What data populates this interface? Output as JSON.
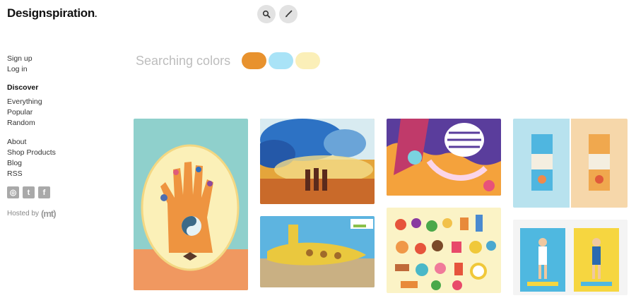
{
  "header": {
    "logo_text": "Designspiration",
    "logo_suffix": "."
  },
  "top_buttons": [
    {
      "icon": "search-icon"
    },
    {
      "icon": "brush-icon"
    }
  ],
  "sidebar": {
    "auth": [
      "Sign up",
      "Log in"
    ],
    "discover_heading": "Discover",
    "discover_items": [
      "Everything",
      "Popular",
      "Random"
    ],
    "info_items": [
      "About",
      "Shop Products",
      "Blog",
      "RSS"
    ],
    "social_icons": [
      "instagram-icon",
      "twitter-icon",
      "facebook-icon"
    ],
    "social_glyphs": [
      "◎",
      "t",
      "f"
    ],
    "hosted_by": "Hosted by",
    "hosted_logo": "(mt)"
  },
  "search": {
    "label": "Searching colors",
    "colors": [
      "#e8922e",
      "#a9e3f7",
      "#fbefb8"
    ]
  },
  "tiles": [
    {
      "subject": "hand-illustration",
      "colors": [
        "#8fd0cc",
        "#f08a4b"
      ]
    },
    {
      "subject": "colorful-smoke-photo",
      "colors": [
        "#2a78c8",
        "#e5a23c"
      ]
    },
    {
      "subject": "abstract-face-illustration",
      "colors": [
        "#5a3d9c",
        "#f4a23c"
      ]
    },
    {
      "subject": "coconut-water-packaging",
      "colors": [
        "#b9e3ee",
        "#f6d6a8"
      ]
    },
    {
      "subject": "yellow-submarine-photo",
      "colors": [
        "#5db4e0",
        "#e3c35a"
      ]
    },
    {
      "subject": "food-icons-illustration",
      "colors": [
        "#fbf2c4",
        "#e6543c"
      ]
    },
    {
      "subject": "tennis-posters",
      "colors": [
        "#f4f4f4",
        "#4fb8e0"
      ]
    }
  ]
}
